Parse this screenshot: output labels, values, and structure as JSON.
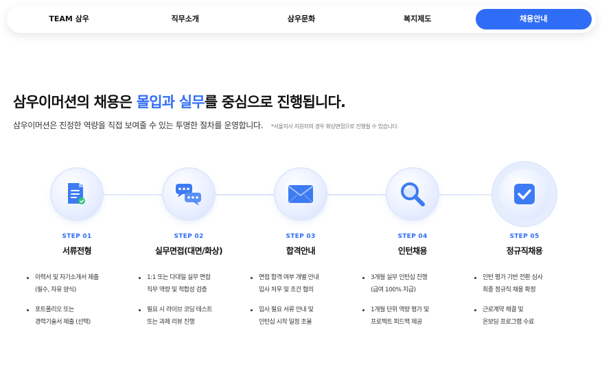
{
  "nav": {
    "tabs": [
      {
        "label": "TEAM 삼우"
      },
      {
        "label": "직무소개"
      },
      {
        "label": "삼우문화"
      },
      {
        "label": "복지제도"
      },
      {
        "label": "채용안내"
      }
    ],
    "active_index": 4
  },
  "hero": {
    "headline_before": "삼우이머션의 채용은 ",
    "headline_accent": "몰입과 실무",
    "headline_after": "를 중심으로 진행됩니다.",
    "description": "삼우이머션은 진정한 역량을 직접 보여줄 수 있는 투명한 절차를 운영합니다.",
    "note": "*서울지사 지원자의 경우 화상면접으로 진행될 수 있습니다."
  },
  "colors": {
    "accent": "#2f6df6",
    "icon_blue": "#3d7bf2"
  },
  "steps": [
    {
      "step": "STEP 01",
      "title": "서류전형",
      "icon": "document-icon",
      "bullets": [
        [
          "이력서 및 자기소개서 제출",
          "(필수, 자유 양식)"
        ],
        [
          "포트폴리오 또는",
          "경력기술서 제출 (선택)"
        ]
      ]
    },
    {
      "step": "STEP 02",
      "title": "실무면접(대면/화상)",
      "icon": "chat-bubbles-icon",
      "bullets": [
        [
          "1:1 또는 다대일 실무 면접",
          "직무 역량 및 적합성 검증"
        ],
        [
          "필요 시 라이브 코딩 테스트",
          "또는 과제 리뷰 진행"
        ]
      ]
    },
    {
      "step": "STEP 03",
      "title": "합격안내",
      "icon": "envelope-icon",
      "bullets": [
        [
          "면접 합격 여부 개별 안내",
          "입사 처우 및 조건 협의"
        ],
        [
          "입사 필요 서류 안내 및",
          "인턴십 시작 일정 조율"
        ]
      ]
    },
    {
      "step": "STEP 04",
      "title": "인턴채용",
      "icon": "magnifier-icon",
      "bullets": [
        [
          "3개월 실무 인턴십 진행",
          "(급여 100% 지급)"
        ],
        [
          "1개월 단위 역량 평가 및",
          "프로젝트 피드백 제공"
        ]
      ]
    },
    {
      "step": "STEP 05",
      "title": "정규직채용",
      "icon": "checkbox-icon",
      "bullets": [
        [
          "인턴 평가 기반 전환 심사",
          "최종 정규직 채용 확정"
        ],
        [
          "근로계약 체결 및",
          "온보딩 프로그램 수료"
        ]
      ]
    }
  ]
}
